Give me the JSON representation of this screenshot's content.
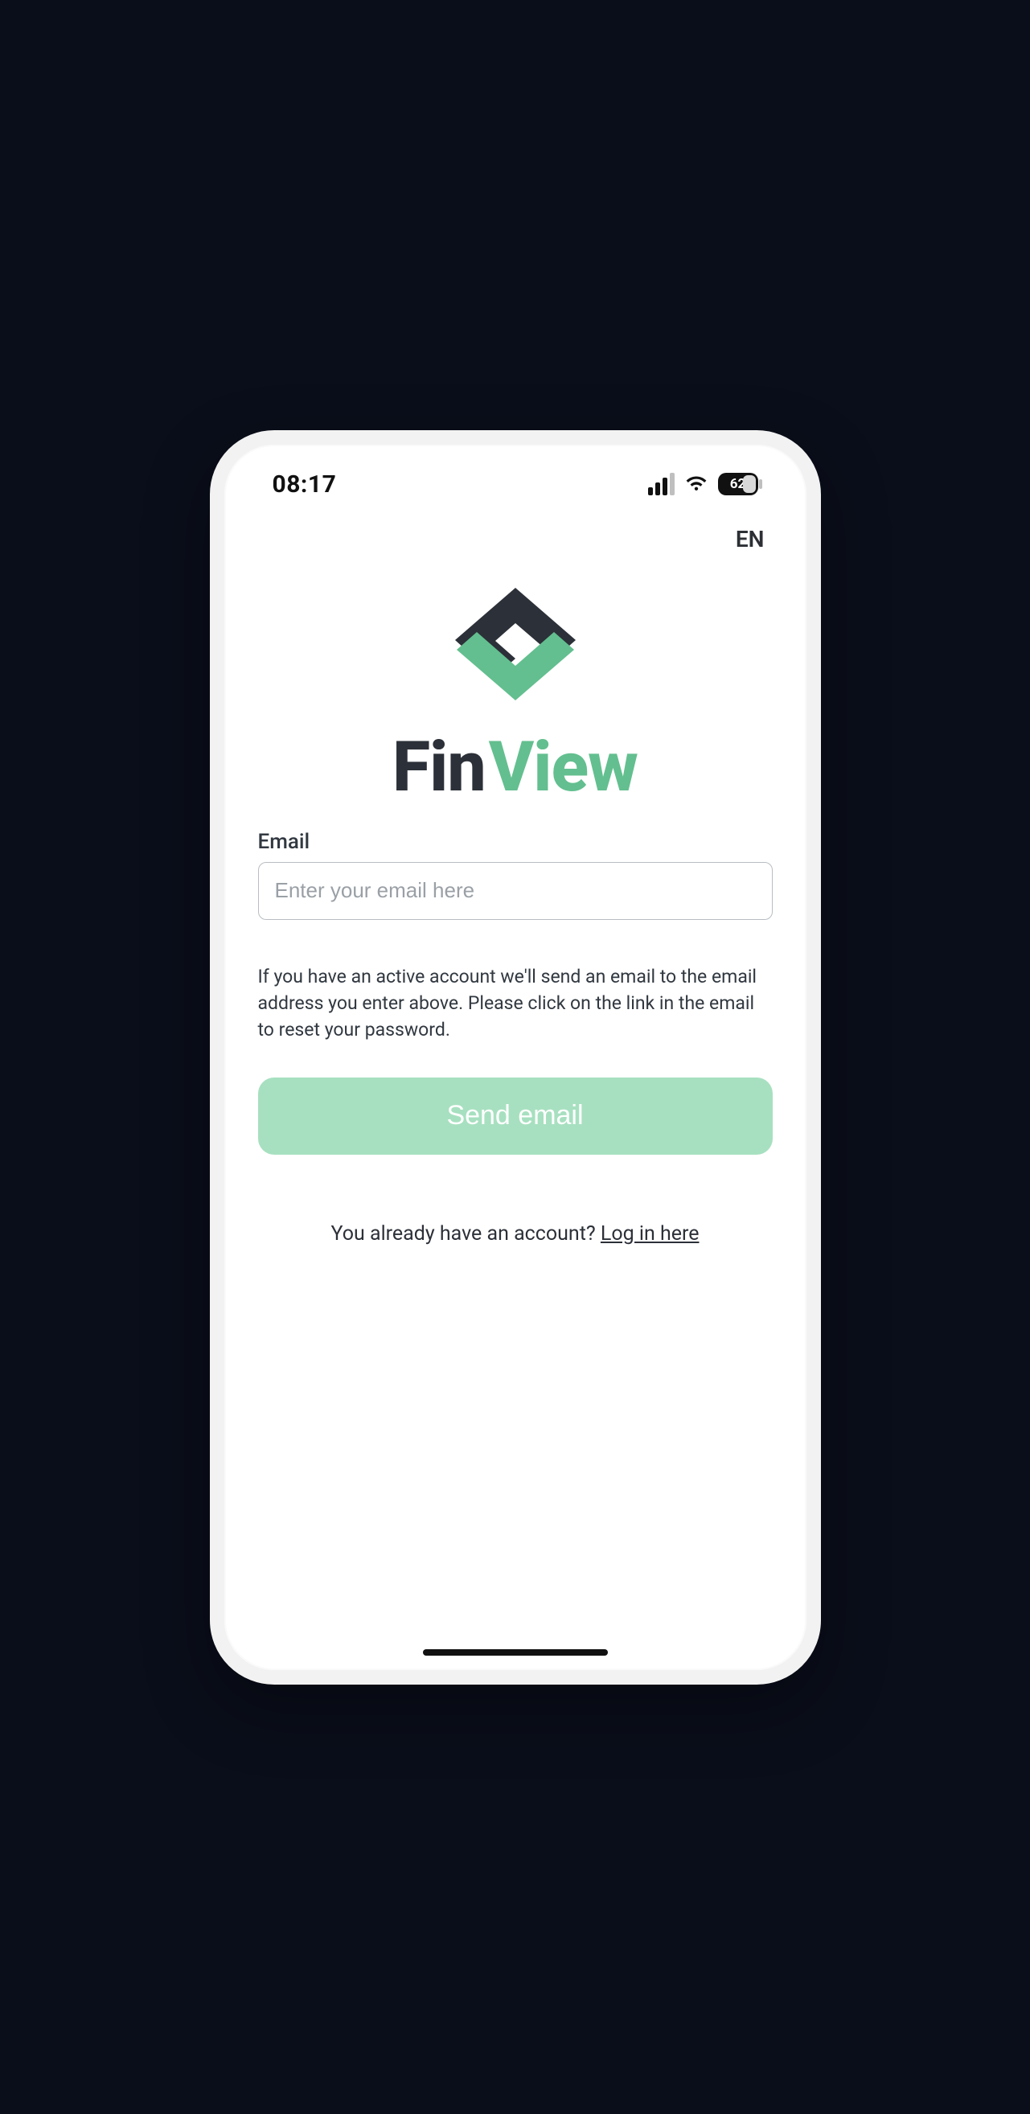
{
  "status": {
    "time": "08:17",
    "battery_pct": "62"
  },
  "header": {
    "lang": "EN"
  },
  "brand": {
    "name_part1": "Fin",
    "name_part2": "View"
  },
  "form": {
    "email_label": "Email",
    "email_placeholder": "Enter your email here",
    "info": "If you have an active account we'll send an email to the email address you enter above. Please click on the link in the email to reset your password.",
    "submit_label": "Send email"
  },
  "footer": {
    "alt_prompt": "You already have an account? ",
    "alt_link": "Log in here"
  },
  "colors": {
    "accent": "#63bf8f",
    "accent_light": "#a7e0c0",
    "text_dark": "#2c3038"
  }
}
